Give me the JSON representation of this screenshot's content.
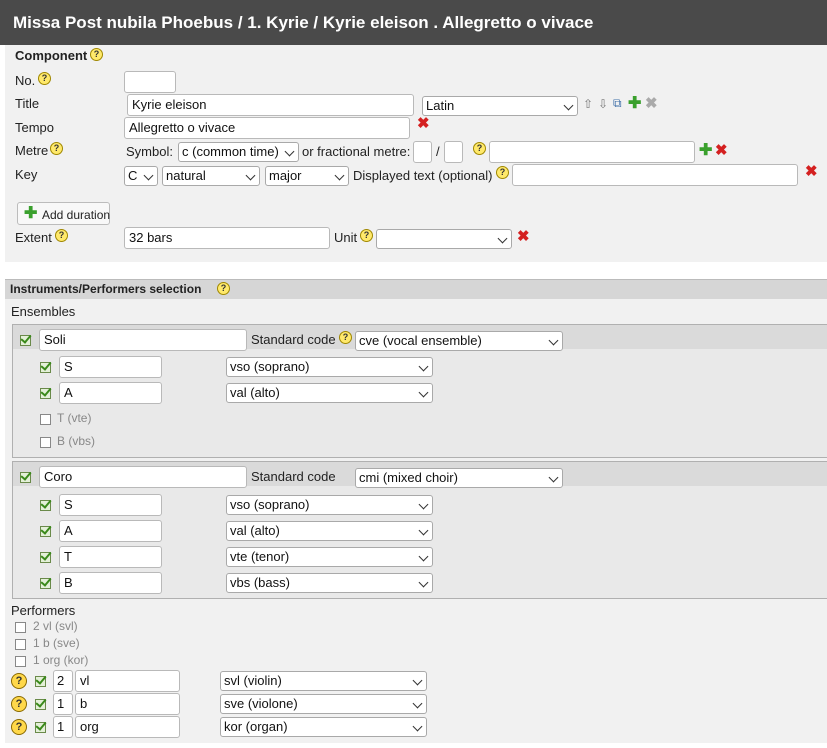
{
  "header": {
    "title": "Missa Post nubila Phoebus / 1. Kyrie / Kyrie eleison . Allegretto o vivace"
  },
  "component": {
    "heading": "Component",
    "no_label": "No.",
    "no_value": "",
    "title_label": "Title",
    "title_value": "Kyrie eleison",
    "language": "Latin",
    "tempo_label": "Tempo",
    "tempo_value": "Allegretto o vivace",
    "metre_label": "Metre",
    "symbol_label": "Symbol:",
    "symbol_value": "c (common time)",
    "fractional_label": "or fractional metre:",
    "fraction_sep": "/",
    "key_label": "Key",
    "key_note": "C",
    "key_accidental": "natural",
    "key_mode": "major",
    "displayed_text_label": "Displayed text (optional)",
    "add_duration_label": "Add duration",
    "extent_label": "Extent",
    "extent_value": "32 bars",
    "unit_label": "Unit",
    "unit_value": ""
  },
  "instruments": {
    "heading": "Instruments/Performers selection",
    "ensembles_label": "Ensembles",
    "standard_code_label": "Standard code",
    "ensembles": [
      {
        "name": "Soli",
        "code": "cve (vocal ensemble)",
        "members": [
          {
            "abbr": "S",
            "code": "vso (soprano)",
            "checked": true
          },
          {
            "abbr": "A",
            "code": "val (alto)",
            "checked": true
          },
          {
            "label": "T (vte)",
            "checked": false
          },
          {
            "label": "B (vbs)",
            "checked": false
          }
        ]
      },
      {
        "name": "Coro",
        "code": "cmi (mixed choir)",
        "members": [
          {
            "abbr": "S",
            "code": "vso (soprano)",
            "checked": true
          },
          {
            "abbr": "A",
            "code": "val (alto)",
            "checked": true
          },
          {
            "abbr": "T",
            "code": "vte (tenor)",
            "checked": true
          },
          {
            "abbr": "B",
            "code": "vbs (bass)",
            "checked": true
          }
        ]
      }
    ],
    "performers_label": "Performers",
    "performer_options": [
      "2 vl (svl)",
      "1 b (sve)",
      "1 org (kor)"
    ],
    "performers": [
      {
        "count": "2",
        "abbr": "vl",
        "code": "svl (violin)"
      },
      {
        "count": "1",
        "abbr": "b",
        "code": "sve (violone)"
      },
      {
        "count": "1",
        "abbr": "org",
        "code": "kor (organ)"
      }
    ]
  },
  "icons": [
    "help-icon",
    "delete-icon",
    "add-icon",
    "move-up-icon",
    "move-down-icon",
    "copy-icon",
    "check-icon",
    "chevron-down-icon"
  ],
  "colors": {
    "title_bg": "#4a4a4a",
    "delete": "#d42020",
    "add": "#3aa02d",
    "help": "#ffe96b"
  }
}
